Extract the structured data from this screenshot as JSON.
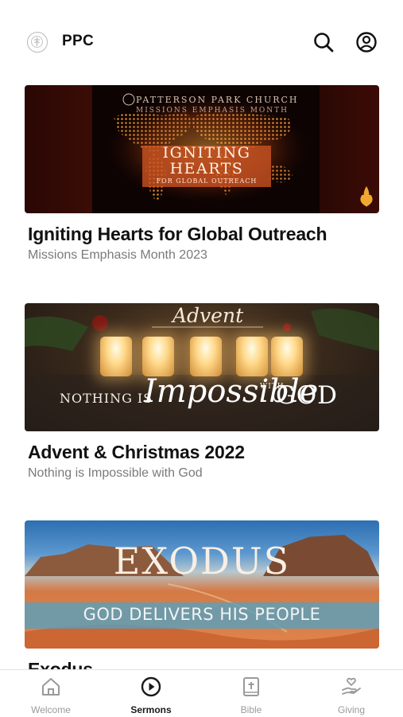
{
  "app": {
    "title": "PPC"
  },
  "header": {
    "search_icon": "search-icon",
    "account_icon": "account-icon"
  },
  "series": [
    {
      "title": "Igniting Hearts for Global Outreach",
      "subtitle": "Missions Emphasis Month 2023",
      "banner": {
        "line1": "PATTERSON PARK CHURCH",
        "line2": "MISSIONS EMPHASIS MONTH",
        "headline1": "IGNITING",
        "headline2": "HEARTS",
        "headline3": "FOR GLOBAL OUTREACH"
      }
    },
    {
      "title": "Advent & Christmas 2022",
      "subtitle": "Nothing is Impossible with God",
      "banner": {
        "script_top": "Advent",
        "left_text": "NOTHING IS",
        "script_main": "Impossible",
        "with": "WITH",
        "right_text": "GOD"
      }
    },
    {
      "title": "Exodus",
      "subtitle": "",
      "banner": {
        "headline": "EXODUS",
        "tagline": "GOD DELIVERS HIS PEOPLE"
      }
    }
  ],
  "tabs": [
    {
      "label": "Welcome",
      "icon": "home-icon",
      "active": false
    },
    {
      "label": "Sermons",
      "icon": "play-icon",
      "active": true
    },
    {
      "label": "Bible",
      "icon": "bible-icon",
      "active": false
    },
    {
      "label": "Giving",
      "icon": "giving-icon",
      "active": false
    }
  ],
  "colors": {
    "active_tab": "#1a1a1a",
    "inactive_tab": "#9a9a9a",
    "subtitle": "#7a7a7a"
  }
}
